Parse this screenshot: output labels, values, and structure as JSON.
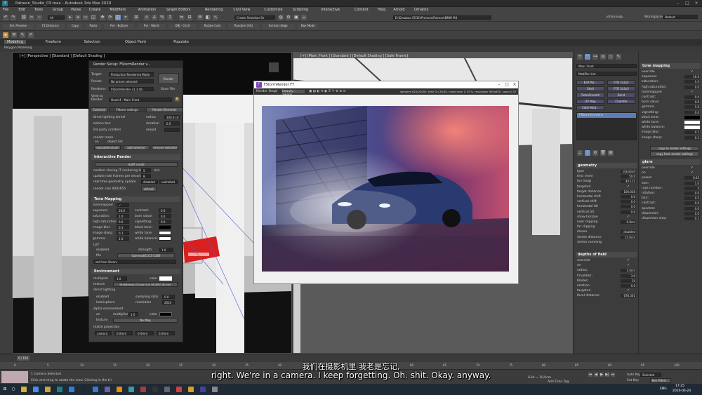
{
  "window": {
    "title": "Patreon_Studio_03.max - Autodesk 3ds Max 2020"
  },
  "menubar": [
    "File",
    "Edit",
    "Tools",
    "Group",
    "Views",
    "Create",
    "Modifiers",
    "Animation",
    "Graph Editors",
    "Rendering",
    "Civil View",
    "Customize",
    "Scripting",
    "Interactive",
    "Content",
    "Help",
    "Arnold",
    "Ornatrix"
  ],
  "account": {
    "user": "johanno@...",
    "workspaces_label": "Workspaces:",
    "workspace": "Default"
  },
  "toolbar": {
    "all_select": "All",
    "selection_set": "Create Selection Se",
    "project_path": "D:\\Dropbox (ZCD)\\Projects\\Patreon\\BMW M4",
    "tools": [
      "Sel. Preview",
      "F2 Distance",
      "Copy",
      "Paste",
      "Pvt - Bottom",
      "Pvt - World",
      "OBJ - 0,0,0",
      "Rotate Cam",
      "Random (Alt)",
      "Sel.Sort.Edge",
      "Box Mode"
    ]
  },
  "ribbon": {
    "tabs": [
      "Modeling",
      "Freeform",
      "Selection",
      "Object Paint",
      "Populate"
    ],
    "sub": "Polygon Modeling"
  },
  "viewports": {
    "left_label": "[+] [Perspective ] [Standard ] [Default Shading ]",
    "right_label": "[+] [Main_Front ] [Standard ] [Default Shading ] [Safe Frame]"
  },
  "render_setup": {
    "title": "Render Setup: FStormRender v...",
    "target_label": "Target:",
    "target": "Production Rendering Mode",
    "preset_label": "Preset:",
    "preset": "No preset selected",
    "renderer_label": "Renderer:",
    "renderer": "FStormRender v1.3.4b",
    "save_file": "Save File",
    "view_label": "View to Render:",
    "view": "Quad 4 - Main_Front",
    "render_btn": "Render",
    "tabs": [
      "Common",
      "FStorm settings",
      "Render Elements"
    ],
    "rows_top": [
      {
        "label": "direct lighting kernel",
        "v2l": "radius",
        "v2": "100.0 cm"
      },
      {
        "label": "motion blur",
        "v2l": "duration",
        "v2": "0.5"
      },
      {
        "label": "3rd party scatters",
        "v2l": "reload",
        "v2": ""
      }
    ],
    "render_mask": "render mask",
    "mask_on": "on",
    "mask_list": "object list",
    "mask_btns": [
      "exclude/include",
      "add selected",
      "remove selected"
    ],
    "interactive": {
      "title": "Interactive Render",
      "mode_btn": "IsoRT mode",
      "confirm": "confirm closing IT rendering longer",
      "confirm_v": "5",
      "confirm_unit": "min",
      "update": "update rate frames per seconds",
      "update_v": "8",
      "realtime": "real time geometry update",
      "realtime_v": "disabled",
      "realtime_v2": "unlimited",
      "size_label": "render size 900x655",
      "refresh": "refresh"
    },
    "tone": {
      "title": "Tone Mapping",
      "rows": [
        {
          "a": "tonemapped",
          "av": "✓",
          "b": "",
          "bv": ""
        },
        {
          "a": "exposure:",
          "av": "16.0",
          "b": "contrast:",
          "bv": "0.0"
        },
        {
          "a": "saturation:",
          "av": "1.0",
          "b": "burn value:",
          "bv": "0.0"
        },
        {
          "a": "high saturation:",
          "av": "0.0",
          "b": "vignetting:",
          "bv": "0.0"
        },
        {
          "a": "image blur:",
          "av": "0.1",
          "b": "black tone:",
          "bv": ""
        },
        {
          "a": "image sharp:",
          "av": "0.1",
          "b": "white tone:",
          "bv": ""
        },
        {
          "a": "gamma:",
          "av": "1.0",
          "b": "white balance:",
          "bv": ""
        }
      ],
      "lut": "LUT",
      "lut_enabled": "enabled",
      "lut_strength": "strength:",
      "lut_strength_v": "1.0",
      "lut_file_label": "file",
      "lut_file": "Gamma4K1C3.CUBE",
      "lut_library": "set from library"
    },
    "environment": {
      "title": "Environment",
      "multiplier_label": "multiplier",
      "multiplier": "1.0",
      "color_label": "color",
      "texture_label": "texture",
      "texture": "MultiBitmap (Cloudy Sun 38.0000 4K.hdr)",
      "direct_lighting": "direct lighting",
      "enabled": "enabled",
      "sampling_label": "sampling ratio",
      "sampling": "0.0",
      "hemisphere": "hemisphere",
      "resolution_label": "resolution",
      "resolution": "2024",
      "alpha": "alpha environment",
      "alpha_on": "on",
      "alpha_mult_label": "multiplier",
      "alpha_mult": "1.0",
      "alpha_color": "color",
      "alpha_tex": "texture",
      "alpha_tex_v": "No Map",
      "matte": "matte projection",
      "matte_cam": "camera",
      "matte_vals": [
        "0.0mm",
        "0.0mm",
        "0.0mm"
      ]
    }
  },
  "frame_buffer": {
    "title": "FStormRender FT",
    "stage": "Render Stage",
    "stage_sel": "beauty - aware",
    "stats": "samples 625/20000, time 1h 26:40, noise level 0.33 %, resolution 900x655, zoom 0.57"
  },
  "command_panel": {
    "object": "Main_Front",
    "modifier_list": "Modifier List",
    "mod_btns": [
      [
        "Edit Pol...",
        "FFD 2x2x2"
      ],
      [
        "Shell",
        "FFD 3x3x3"
      ],
      [
        "TurboSmooth",
        "Bend"
      ],
      [
        "UV Map",
        "Chamfer"
      ],
      [
        "Cloth Mod...",
        ""
      ]
    ],
    "stack_item": "FStormCamera",
    "geometry": {
      "title": "geometry",
      "rows": [
        {
          "l": "type",
          "v": "standard"
        },
        {
          "l": "lens (mm)",
          "v": "50.0"
        },
        {
          "l": "fov (deg)",
          "v": "40.111"
        },
        {
          "l": "targeted",
          "v": "✓"
        },
        {
          "l": "target distance",
          "v": "100.036"
        },
        {
          "l": "horizontal shift",
          "v": "0.0"
        },
        {
          "l": "vertical shift",
          "v": "0.0"
        },
        {
          "l": "horizontal tilt",
          "v": "0.0"
        },
        {
          "l": "vertical tilt",
          "v": "0.0"
        },
        {
          "l": "show horizon",
          "v": "✓"
        },
        {
          "l": "near clipping",
          "v": "0.0cm"
        },
        {
          "l": "far clipping",
          "v": ""
        },
        {
          "l": "stereo",
          "v": "disabled"
        },
        {
          "l": "stereo distance",
          "v": "15.0cm"
        },
        {
          "l": "stereo conveng.",
          "v": ""
        }
      ]
    },
    "dof": {
      "title": "depths of field",
      "rows": [
        {
          "l": "override",
          "v": "✓"
        },
        {
          "l": "on",
          "v": "✓"
        },
        {
          "l": "radius:",
          "v": "1.0cm"
        },
        {
          "l": "f-number:",
          "v": "3.0"
        },
        {
          "l": "blades:",
          "v": "10"
        },
        {
          "l": "rotation:",
          "v": "0.0"
        },
        {
          "l": "targeted",
          "v": "✓"
        },
        {
          "l": "focal distance:",
          "v": "678.301"
        }
      ]
    },
    "tone": {
      "title": "tone mapping",
      "rows": [
        {
          "l": "override",
          "v": "✓"
        },
        {
          "l": "exposure:",
          "v": "16.0"
        },
        {
          "l": "saturation:",
          "v": "1.0"
        },
        {
          "l": "high saturation:",
          "v": "0.0"
        },
        {
          "l": "tonemapped",
          "v": "✓"
        },
        {
          "l": "contrast:",
          "v": "0.0"
        },
        {
          "l": "burn value:",
          "v": "0.0"
        },
        {
          "l": "gamma:",
          "v": "1.0"
        },
        {
          "l": "vignetting:",
          "v": "0.0"
        },
        {
          "l": "black tone:",
          "v": ""
        },
        {
          "l": "white tone:",
          "v": ""
        },
        {
          "l": "white balance:",
          "v": ""
        },
        {
          "l": "image blur:",
          "v": "0.1"
        },
        {
          "l": "image sharp:",
          "v": "0.1"
        }
      ],
      "copy1": "copy to render settings",
      "copy2": "copy from render settings"
    },
    "glare": {
      "title": "glare",
      "rows": [
        {
          "l": "override",
          "v": "✓"
        },
        {
          "l": "on",
          "v": "✓"
        },
        {
          "l": "power:",
          "v": "0.05"
        },
        {
          "l": "size:",
          "v": "1.0"
        },
        {
          "l": "rays number:",
          "v": "4"
        },
        {
          "l": "rotation:",
          "v": "0.0"
        },
        {
          "l": "blur:",
          "v": "0.5"
        },
        {
          "l": "contrast:",
          "v": "0.0"
        },
        {
          "l": "spectral:",
          "v": "0.0"
        },
        {
          "l": "dispersion:",
          "v": "0.0"
        },
        {
          "l": "dispersion step:",
          "v": "0.1"
        }
      ]
    }
  },
  "timeline": {
    "frame": "0 / 100",
    "ticks": [
      "0",
      "5",
      "10",
      "15",
      "20",
      "25",
      "30",
      "35",
      "40",
      "45",
      "50",
      "55",
      "60",
      "65",
      "70",
      "75",
      "80",
      "85",
      "90",
      "95",
      "100"
    ]
  },
  "status": {
    "selected": "1 Camera Selected",
    "hint": "Click and drag to rotate the view. Clicking in the tri",
    "grid": "Grid = 10,0cm",
    "add_tag": "Add Time Tag",
    "auto": "Auto Key",
    "setkey": "Set Key",
    "selected_dd": "Selected",
    "keyfilters": "Key Filters..."
  },
  "taskbar": {
    "time": "17:25",
    "date": "2020-04-24",
    "lang": "ENG"
  },
  "subtitles": {
    "zh": "我们在摄影机里 我老是忘记,",
    "en": "right. We're in a camera. I keep forgetting. Oh. shit. Okay. anyway."
  }
}
